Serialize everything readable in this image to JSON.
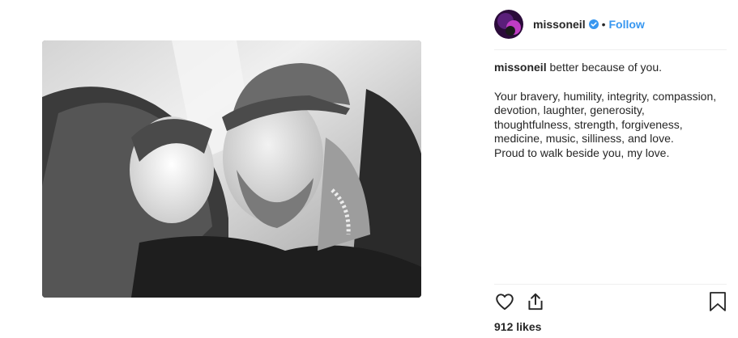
{
  "post": {
    "username": "missoneil",
    "verified": true,
    "separator": "•",
    "follow_label": "Follow",
    "caption": {
      "author": "missoneil",
      "first_line": "better because of you.",
      "lines": [
        "Your bravery, humility, integrity, compassion,",
        "devotion, laughter, generosity,",
        "thoughtfulness, strength, forgiveness,",
        "medicine, music, silliness, and love.",
        "Proud to walk beside you, my love."
      ]
    },
    "likes_count": "912",
    "likes_label": "likes"
  },
  "icons": {
    "like": "heart-outline-icon",
    "share": "share-upload-icon",
    "save": "bookmark-outline-icon",
    "verified": "verified-badge-icon"
  },
  "colors": {
    "follow": "#3897f0",
    "verified_badge": "#3897f0",
    "text": "#262626",
    "divider": "#efefef"
  }
}
